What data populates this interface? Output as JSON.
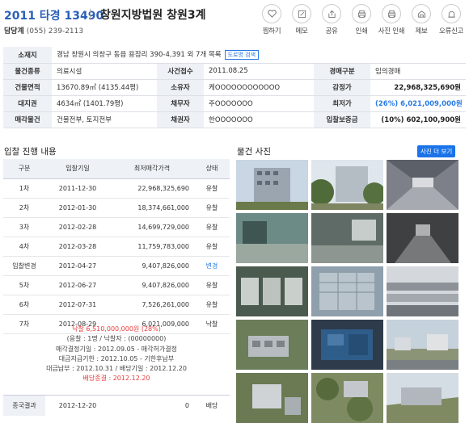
{
  "header": {
    "case_label": "2011 타경 13490",
    "court": "창원지방법원 창원3계",
    "contact_label": "담당계",
    "phone": "(055) 239-2113"
  },
  "actions": [
    {
      "label": "찜하기",
      "icon": "heart-icon"
    },
    {
      "label": "메모",
      "icon": "memo-icon"
    },
    {
      "label": "공유",
      "icon": "share-icon"
    },
    {
      "label": "인쇄",
      "icon": "print-icon"
    },
    {
      "label": "사진 인쇄",
      "icon": "photo-print-icon"
    },
    {
      "label": "제보",
      "icon": "report-icon"
    },
    {
      "label": "오류신고",
      "icon": "error-report-icon"
    }
  ],
  "info": {
    "address_h": "소재지",
    "address": "경남 창원시 의창구 동읍 용잠리 390-4,391 외 7개 목록",
    "road_btn": "도로명 검색",
    "type_h": "물건종류",
    "type": "의료시설",
    "received_h": "사건접수",
    "received": "2011.08.25",
    "auction_h": "경매구분",
    "auction": "임의경매",
    "bldg_h": "건물면적",
    "bldg": "13670.89㎡ (4135.44평)",
    "owner_h": "소유자",
    "owner": "케OOOOOOOOOOOO",
    "appraisal_h": "감정가",
    "appraisal": "22,968,325,690원",
    "land_h": "대지권",
    "land": "4634㎡ (1401.79평)",
    "debtor_h": "채무자",
    "debtor": "주OOOOOOO",
    "min_h": "최저가",
    "min": "(26%) 6,021,009,000원",
    "sale_h": "매각물건",
    "sale": "건물전부, 토지전부",
    "creditor_h": "채권자",
    "creditor": "한OOOOOOO",
    "deposit_h": "입찰보증금",
    "deposit": "(10%) 602,100,900원"
  },
  "bid": {
    "title": "입찰 진행 내용",
    "headers": [
      "구분",
      "입찰기일",
      "최저매각가격",
      "상태"
    ],
    "rows": [
      [
        "1차",
        "2011-12-30",
        "22,968,325,690",
        "유찰"
      ],
      [
        "2차",
        "2012-01-30",
        "18,374,661,000",
        "유찰"
      ],
      [
        "3차",
        "2012-02-28",
        "14,699,729,000",
        "유찰"
      ],
      [
        "4차",
        "2012-03-28",
        "11,759,783,000",
        "유찰"
      ],
      [
        "입찰변경",
        "2012-04-27",
        "9,407,826,000",
        "변경"
      ],
      [
        "5차",
        "2012-06-27",
        "9,407,826,000",
        "유찰"
      ],
      [
        "6차",
        "2012-07-31",
        "7,526,261,000",
        "유찰"
      ],
      [
        "7차",
        "2012-08-29",
        "6,021,009,000",
        "낙찰"
      ]
    ]
  },
  "summary": {
    "winning": "낙찰 6,510,000,000원 (28%)",
    "bidders": "(응찰 : 1명 / 낙찰자 : (00000000)",
    "decision": "매각결정기일 : 2012.09.05 - 매각허가결정",
    "deadline": "대금지급기한 : 2012.10.05 - 기한후납부",
    "payment": "대금납부 : 2012.10.31 / 배당기일 : 2012.12.20",
    "dividend": "배당종결 : 2012.12.20"
  },
  "final": {
    "h": "종국결과",
    "date": "2012-12-20",
    "amount": "0",
    "status": "배당"
  },
  "photos": {
    "title": "물건 사진",
    "more": "사진 더 보기"
  }
}
